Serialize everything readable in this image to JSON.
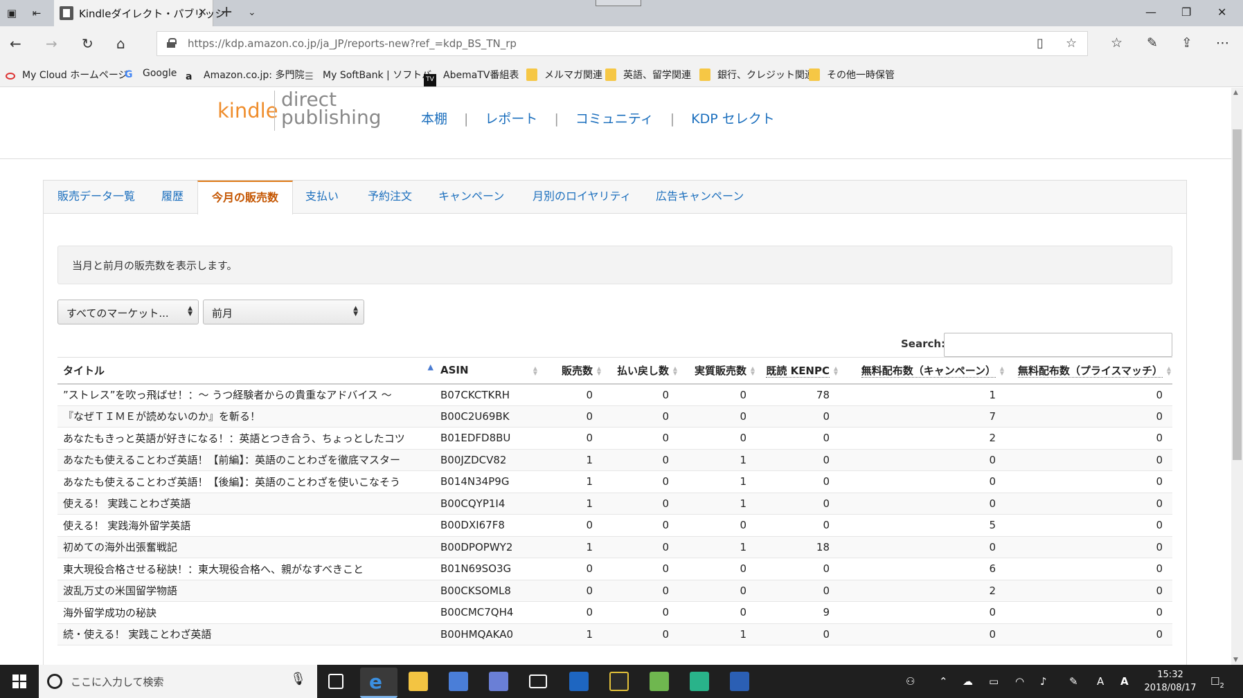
{
  "browser": {
    "tab_title": "Kindleダイレクト・パブリッシ",
    "url": "https://kdp.amazon.co.jp/ja_JP/reports-new?ref_=kdp_BS_TN_rp",
    "favorites": [
      "My Cloud ホームページ",
      "Google",
      "Amazon.co.jp: 多門院",
      "My SoftBank | ソフトバ",
      "AbemaTV番組表",
      "メルマガ関連",
      "英語、留学関連",
      "銀行、クレジット関連",
      "その他一時保管"
    ]
  },
  "kdp": {
    "logo_kindle": "kindle",
    "logo_direct": "direct",
    "logo_publishing": "publishing",
    "nav": [
      "本棚",
      "レポート",
      "コミュニティ",
      "KDP セレクト"
    ],
    "tabs": [
      "販売データ一覧",
      "履歴",
      "今月の販売数",
      "支払い",
      "予約注文",
      "キャンペーン",
      "月別のロイヤリティ",
      "広告キャンペーン"
    ],
    "active_tab": "今月の販売数",
    "info_text": "当月と前月の販売数を表示します。",
    "market_select": "すべてのマーケット...",
    "period_select": "前月",
    "search_label": "Search:",
    "search_value": "",
    "columns": [
      "タイトル",
      "ASIN",
      "販売数",
      "払い戻し数",
      "実質販売数",
      "既読 KENPC",
      "無料配布数（キャンペーン）",
      "無料配布数（プライスマッチ）"
    ],
    "rows": [
      [
        "”ストレス”を吹っ飛ばせ！：～ うつ経験者からの貴重なアドバイス ～",
        "B07CKCTKRH",
        "0",
        "0",
        "0",
        "78",
        "1",
        "0"
      ],
      [
        "『なぜＴＩＭＥが読めないのか』を斬る！",
        "B00C2U69BK",
        "0",
        "0",
        "0",
        "0",
        "7",
        "0"
      ],
      [
        "あなたもきっと英語が好きになる！：英語とつき合う、ちょっとしたコツ",
        "B01EDFD8BU",
        "0",
        "0",
        "0",
        "0",
        "2",
        "0"
      ],
      [
        "あなたも使えることわざ英語！【前編】：英語のことわざを徹底マスター",
        "B00JZDCV82",
        "1",
        "0",
        "1",
        "0",
        "0",
        "0"
      ],
      [
        "あなたも使えることわざ英語！【後編】：英語のことわざを使いこなそう",
        "B014N34P9G",
        "1",
        "0",
        "1",
        "0",
        "0",
        "0"
      ],
      [
        "使える！ 実践ことわざ英語",
        "B00CQYP1I4",
        "1",
        "0",
        "1",
        "0",
        "0",
        "0"
      ],
      [
        "使える！ 実践海外留学英語",
        "B00DXI67F8",
        "0",
        "0",
        "0",
        "0",
        "5",
        "0"
      ],
      [
        "初めての海外出張奮戦記",
        "B00DPOPWY2",
        "1",
        "0",
        "1",
        "18",
        "0",
        "0"
      ],
      [
        "東大現役合格させる秘訣！：東大現役合格へ、親がなすべきこと",
        "B01N69SO3G",
        "0",
        "0",
        "0",
        "0",
        "6",
        "0"
      ],
      [
        "波乱万丈の米国留学物語",
        "B00CKSOML8",
        "0",
        "0",
        "0",
        "0",
        "2",
        "0"
      ],
      [
        "海外留学成功の秘訣",
        "B00CMC7QH4",
        "0",
        "0",
        "0",
        "9",
        "0",
        "0"
      ],
      [
        "続・使える！ 実践ことわざ英語",
        "B00HMQAKA0",
        "1",
        "0",
        "1",
        "0",
        "0",
        "0"
      ]
    ]
  },
  "taskbar": {
    "search_placeholder": "ここに入力して検索",
    "time": "15:32",
    "date": "2018/08/17",
    "notification_count": "2"
  },
  "colors": {
    "kindle_orange": "#ef8d2c",
    "link_blue": "#1a6ebd",
    "active_tab_text": "#c45500"
  }
}
